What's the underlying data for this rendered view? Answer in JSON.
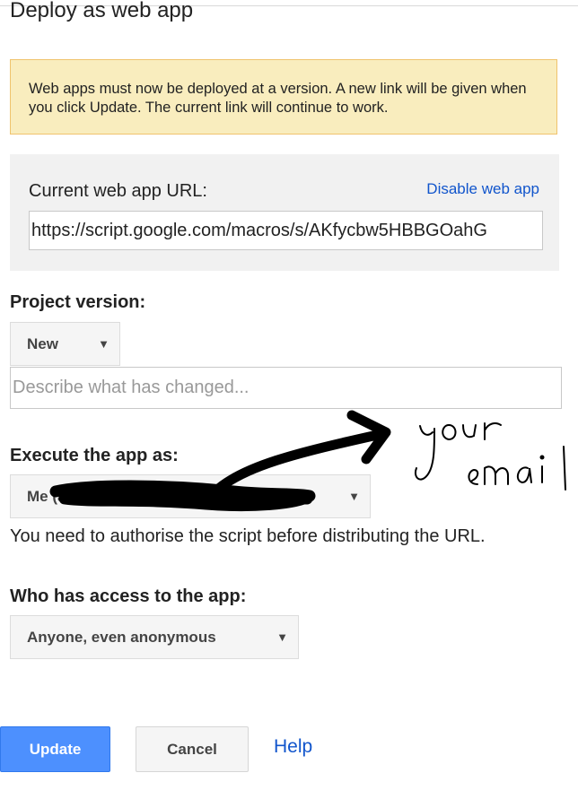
{
  "dialog": {
    "title": "Deploy as web app",
    "notice": "Web apps must now be deployed at a version. A new link will be given when you click Update. The current link will continue to work."
  },
  "url_section": {
    "label": "Current web app URL:",
    "disable_link": "Disable web app",
    "url_value": "https://script.google.com/macros/s/AKfycbw5HBBGOahG"
  },
  "project_version": {
    "label": "Project version:",
    "selected": "New",
    "describe_placeholder": "Describe what has changed..."
  },
  "execute_as": {
    "label": "Execute the app as:",
    "selected_prefix": "Me (a",
    "selected_suffix": ")",
    "auth_note": "You need to authorise the script before distributing the URL."
  },
  "access": {
    "label": "Who has access to the app:",
    "selected": "Anyone, even anonymous"
  },
  "annotation": {
    "line1": "your",
    "line2": "email"
  },
  "buttons": {
    "update": "Update",
    "cancel": "Cancel",
    "help": "Help"
  },
  "icons": {
    "dropdown": "dropdown-arrow-icon"
  },
  "colors": {
    "notice_bg": "#f9edbe",
    "notice_border": "#f0c36d",
    "primary_button": "#4d90fe",
    "link": "#1155cc"
  }
}
